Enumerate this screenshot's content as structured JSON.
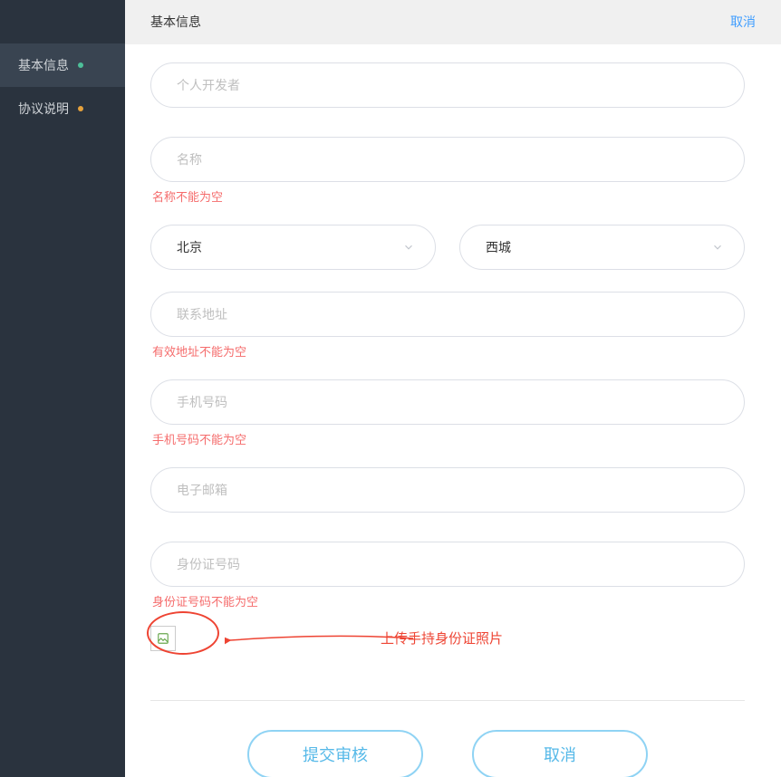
{
  "header": {
    "title": "基本信息",
    "cancel": "取消"
  },
  "sidebar": {
    "items": [
      {
        "label": "基本信息"
      },
      {
        "label": "协议说明"
      }
    ]
  },
  "form": {
    "developer": {
      "placeholder": "个人开发者",
      "value": ""
    },
    "name": {
      "placeholder": "名称",
      "value": "",
      "error": "名称不能为空"
    },
    "province": {
      "value": "北京"
    },
    "city": {
      "value": "西城"
    },
    "address": {
      "placeholder": "联系地址",
      "value": "",
      "error": "有效地址不能为空"
    },
    "phone": {
      "placeholder": "手机号码",
      "value": "",
      "error": "手机号码不能为空"
    },
    "email": {
      "placeholder": "电子邮箱",
      "value": ""
    },
    "idcard": {
      "placeholder": "身份证号码",
      "value": "",
      "error": "身份证号码不能为空"
    },
    "upload": {
      "annotation": "上传手持身份证照片"
    }
  },
  "buttons": {
    "submit": "提交审核",
    "cancel": "取消"
  }
}
